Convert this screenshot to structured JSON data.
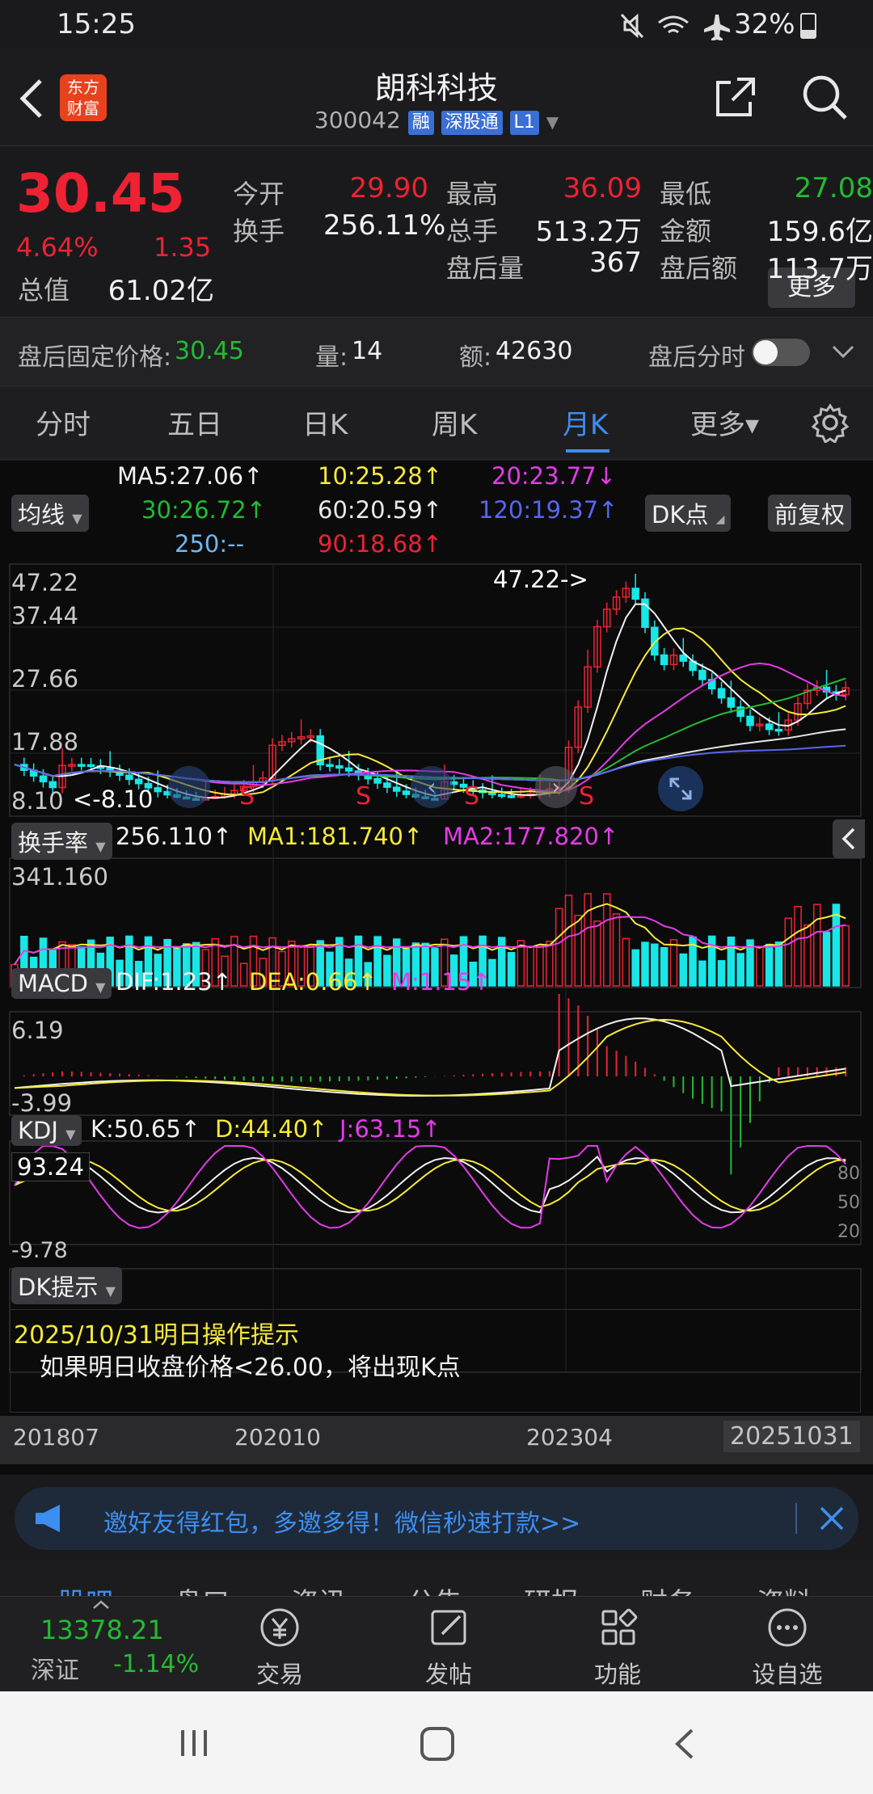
{
  "status_bar": {
    "time": "15:25",
    "battery": "32%"
  },
  "header": {
    "logo_text": "东方\n财富",
    "stock_name": "朗科科技",
    "stock_code": "300042",
    "tags": [
      "融",
      "深股通",
      "L1"
    ]
  },
  "quote": {
    "price": "30.45",
    "change_pct": "4.64%",
    "change": "1.35",
    "rows": [
      [
        {
          "label": "今开",
          "value": "29.90",
          "color": "#ee2233"
        },
        {
          "label": "最高",
          "value": "36.09",
          "color": "#ee2233"
        },
        {
          "label": "最低",
          "value": "27.08",
          "color": "#22bb33"
        }
      ],
      [
        {
          "label": "换手",
          "value": "256.11%",
          "color": "#f2f2f2"
        },
        {
          "label": "总手",
          "value": "513.2万",
          "color": "#f2f2f2"
        },
        {
          "label": "金额",
          "value": "159.6亿",
          "color": "#f2f2f2"
        }
      ],
      [
        {
          "label": "总值",
          "value": "61.02亿",
          "color": "#f2f2f2"
        },
        {
          "label": "盘后量",
          "value": "367",
          "color": "#f2f2f2"
        },
        {
          "label": "盘后额",
          "value": "113.7万",
          "color": "#f2f2f2"
        }
      ]
    ],
    "more_button": "更多"
  },
  "after_hours": {
    "fixed_price_label": "盘后固定价格:",
    "fixed_price": "30.45",
    "volume_label": "量:",
    "volume": "14",
    "amount_label": "额:",
    "amount": "42630",
    "timeshare_label": "盘后分时"
  },
  "period_tabs": [
    "分时",
    "五日",
    "日K",
    "周K",
    "月K",
    "更多▾"
  ],
  "active_tab": "月K",
  "ma_legend": {
    "ma_button": "均线",
    "dk_button": "DK点",
    "restore_button": "前复权",
    "items": [
      {
        "text": "MA5:27.06↑",
        "color": "#f2f2f2"
      },
      {
        "text": "10:25.28↑",
        "color": "#f6e93a"
      },
      {
        "text": "20:23.77↓",
        "color": "#e43ce6"
      },
      {
        "text": "30:26.72↑",
        "color": "#22bb33"
      },
      {
        "text": "60:20.59↑",
        "color": "#e8e8e8"
      },
      {
        "text": "120:19.37↑",
        "color": "#5866f0"
      },
      {
        "text": "250:--",
        "color": "#6fb8f0"
      },
      {
        "text": "90:18.68↑",
        "color": "#ee2233"
      }
    ]
  },
  "kline": {
    "y_labels": [
      "47.22",
      "37.44",
      "27.66",
      "17.88",
      "8.10"
    ],
    "high_marker": "47.22->",
    "low_marker": "<-8.10",
    "signal_label": "S"
  },
  "turnover": {
    "button": "换手率",
    "value": "256.110↑",
    "ma1": "MA1:181.740↑",
    "ma2": "MA2:177.820↑",
    "y_top": "341.160"
  },
  "macd": {
    "button": "MACD",
    "dif": "DIF:1.23↑",
    "dea": "DEA:0.66↑",
    "m": "M:1.15↑",
    "y_top": "6.19",
    "y_bottom": "-3.99"
  },
  "kdj": {
    "button": "KDJ",
    "k": "K:50.65↑",
    "d": "D:44.40↑",
    "j": "J:63.15↑",
    "y_top": "93.24",
    "y_bottom": "-9.78",
    "levels": [
      "80",
      "50",
      "20"
    ]
  },
  "dk_tip": {
    "button": "DK提示",
    "title": "2025/10/31明日操作提示",
    "text": "如果明日收盘价格<26.00，将出现K点"
  },
  "x_axis": [
    "201807",
    "202010",
    "202304",
    "20251031"
  ],
  "banner": {
    "text": "邀好友得红包，多邀多得！微信秒速打款>>"
  },
  "bottom_tabs": [
    "股吧",
    "盘口",
    "资讯",
    "公告",
    "研报",
    "财务",
    "资料"
  ],
  "index": {
    "value": "13378.21",
    "name": "深证",
    "change": "-1.14%"
  },
  "bottom_buttons": [
    {
      "label": "交易",
      "icon": "yen-icon"
    },
    {
      "label": "发帖",
      "icon": "edit-icon"
    },
    {
      "label": "功能",
      "icon": "grid-icon"
    },
    {
      "label": "设自选",
      "icon": "more-icon"
    }
  ]
}
